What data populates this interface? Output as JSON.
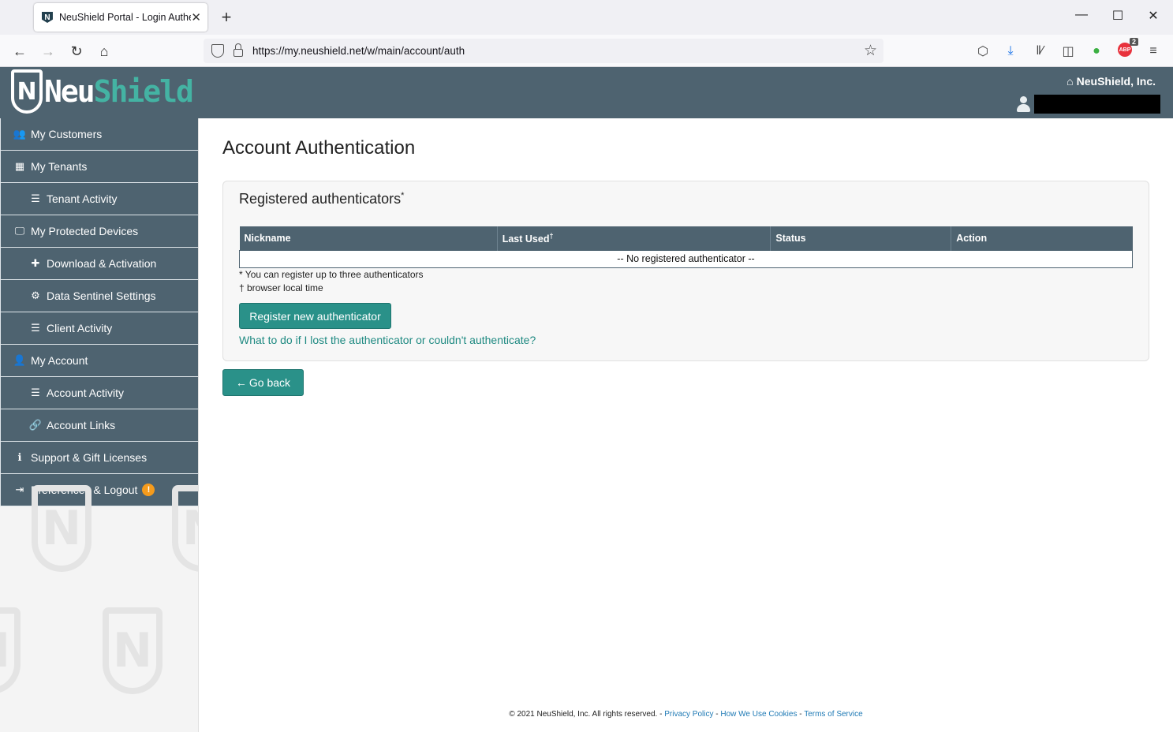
{
  "browser": {
    "tab_title": "NeuShield Portal - Login Authen",
    "tab_favicon": "N",
    "tab_close": "✕",
    "new_tab": "+",
    "url": "https://my.neushield.net/w/main/account/auth",
    "abp_label": "ABP",
    "abp_badge": "2",
    "window_controls": {
      "minimize": "—",
      "maximize": "☐",
      "close": "✕"
    }
  },
  "header": {
    "logo_part1": "Neu",
    "logo_part2": "Shield",
    "logo_glyph": "N",
    "org_name": "NeuShield, Inc.",
    "colors": {
      "header_bg": "#4e6370",
      "accent": "#44b3a3"
    }
  },
  "sidebar": {
    "items": [
      {
        "label": "My Customers",
        "icon": "users-icon",
        "glyph": "👥"
      },
      {
        "label": "My Tenants",
        "icon": "building-icon",
        "glyph": "▦"
      },
      {
        "label": "Tenant Activity",
        "icon": "list-icon",
        "glyph": "☰"
      },
      {
        "label": "My Protected Devices",
        "icon": "desktop-icon",
        "glyph": "🖵"
      },
      {
        "label": "Download & Activation",
        "icon": "plus-icon",
        "glyph": "✚"
      },
      {
        "label": "Data Sentinel Settings",
        "icon": "gears-icon",
        "glyph": "⚙"
      },
      {
        "label": "Client Activity",
        "icon": "list-icon",
        "glyph": "☰"
      },
      {
        "label": "My Account",
        "icon": "user-icon",
        "glyph": "👤"
      },
      {
        "label": "Account Activity",
        "icon": "list-icon",
        "glyph": "☰"
      },
      {
        "label": "Account Links",
        "icon": "link-icon",
        "glyph": "🔗"
      },
      {
        "label": "Support & Gift Licenses",
        "icon": "info-icon",
        "glyph": "ℹ"
      },
      {
        "label": "Preferences & Logout",
        "icon": "sign-out-icon",
        "glyph": "⇥",
        "badge": "!"
      }
    ]
  },
  "main": {
    "title": "Account Authentication",
    "panel": {
      "title": "Registered authenticators",
      "title_mark": "*",
      "table": {
        "headers": [
          "Nickname",
          "Last Used",
          "Status",
          "Action"
        ],
        "last_used_mark": "†",
        "empty_text": "-- No registered authenticator --"
      },
      "note1": "* You can register up to three authenticators",
      "note2": "† browser local time",
      "register_button": "Register new authenticator",
      "help_link": "What to do if I lost the authenticator or couldn't authenticate?"
    },
    "back_button": "Go back",
    "back_arrow": "←"
  },
  "footer": {
    "copyright": "© 2021 NeuShield, Inc. All rights reserved. -",
    "privacy": "Privacy Policy",
    "cookies": "How We Use Cookies",
    "terms": "Terms of Service",
    "separator": "-"
  }
}
